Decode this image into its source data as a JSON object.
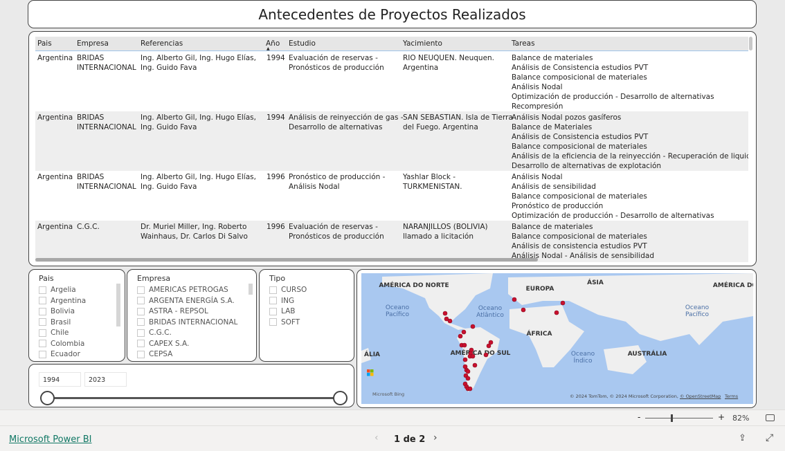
{
  "title": "Antecedentes de Proyectos Realizados",
  "table": {
    "columns": [
      "Pais",
      "Empresa",
      "Referencias",
      "Año",
      "Estudio",
      "Yacimiento",
      "Tareas"
    ],
    "sorted_column": "Año",
    "rows": [
      {
        "pais": "Argentina",
        "empresa": [
          "BRIDAS",
          "INTERNACIONAL"
        ],
        "referencias": [
          "Ing. Alberto Gil, Ing. Hugo Elías,",
          "Ing. Guido Fava"
        ],
        "anio": "1994",
        "estudio": [
          "Evaluación de reservas -",
          "Pronósticos de producción"
        ],
        "yacimiento": [
          "RIO NEUQUEN. Neuquen.",
          "Argentina"
        ],
        "tareas": [
          "Balance de materiales",
          "Análisis de Consistencia estudios PVT",
          "Balance composicional de materiales",
          "Análisis Nodal",
          "Optimización de producción - Desarrollo de alternativas",
          "Recompresión"
        ]
      },
      {
        "pais": "Argentina",
        "empresa": [
          "BRIDAS",
          "INTERNACIONAL"
        ],
        "referencias": [
          "Ing. Alberto Gil, Ing. Hugo Elías,",
          "Ing. Guido Fava"
        ],
        "anio": "1994",
        "estudio": [
          "Análisis de reinyección de gas -",
          "Desarrollo de alternativas"
        ],
        "yacimiento": [
          "SAN SEBASTIAN. Isla de Tierra",
          "del Fuego. Argentina"
        ],
        "tareas": [
          "Análisis Nodal pozos gasíferos",
          "Balance de Materiales",
          "Análisis de Consistencia estudios PVT",
          "Balance composicional de materiales",
          "Análisis de la eficiencia de la reinyección - Recuperación de liquidos",
          "Desarrollo de alternativas de explotación"
        ]
      },
      {
        "pais": "Argentina",
        "empresa": [
          "BRIDAS",
          "INTERNACIONAL"
        ],
        "referencias": [
          "Ing. Alberto Gil, Ing. Hugo Elías,",
          "Ing. Guido Fava"
        ],
        "anio": "1996",
        "estudio": [
          "Pronóstico de producción -",
          "Análisis Nodal"
        ],
        "yacimiento": [
          "Yashlar Block -",
          "TURKMENISTAN."
        ],
        "tareas": [
          "Análisis Nodal",
          "Análisis de sensibilidad",
          "Balance composicional de materiales",
          "Pronóstico de producción",
          "Optimización de producción - Desarrollo de alternativas"
        ]
      },
      {
        "pais": "Argentina",
        "empresa": [
          "C.G.C."
        ],
        "referencias": [
          "Dr. Muriel Miller, Ing. Roberto",
          "Wainhaus, Dr. Carlos Di Salvo"
        ],
        "anio": "1996",
        "estudio": [
          "Evaluación de reservas -",
          "Pronósticos de producción"
        ],
        "yacimiento": [
          "NARANJILLOS (BOLIVIA)",
          "llamado a licitación"
        ],
        "tareas": [
          "Balance de materiales",
          "Balance composicional de materiales",
          "Análisis de consistencia estudios PVT",
          "Análisis Nodal - Análisis de sensibilidad"
        ]
      }
    ]
  },
  "slicers": {
    "pais": {
      "title": "Pais",
      "options": [
        "Argelia",
        "Argentina",
        "Bolivia",
        "Brasil",
        "Chile",
        "Colombia",
        "Ecuador"
      ]
    },
    "empresa": {
      "title": "Empresa",
      "options": [
        "AMERICAS PETROGAS",
        "ARGENTA ENERGÍA S.A.",
        "ASTRA - REPSOL",
        "BRIDAS INTERNACIONAL",
        "C.G.C.",
        "CAPEX S.A.",
        "CEPSA"
      ]
    },
    "tipo": {
      "title": "Tipo",
      "options": [
        "CURSO",
        "ING",
        "LAB",
        "SOFT"
      ]
    },
    "year": {
      "min": "1994",
      "max": "2023"
    }
  },
  "map": {
    "labels": [
      "AMÉRICA DO NORTE",
      "EUROPA",
      "ÁSIA",
      "AMÉRICA DO",
      "Oceano Pacífico",
      "Oceano Atlântico",
      "ÁFRICA",
      "Oceano Pacífico",
      "ÁLIA",
      "AMÉRICA DO SUL",
      "Oceano Índico",
      "AUSTRÁLIA"
    ],
    "logo": "Microsoft Bing",
    "attribution": "© 2024 TomTom, © 2024 Microsoft Corporation,",
    "osm_link": "© OpenStreetMap",
    "terms_link": "Terms",
    "water_color": "#a9c8f0",
    "land_color": "#efefef",
    "marker_color": "#c8102e"
  },
  "zoom": {
    "level": "82%",
    "minus": "-",
    "plus": "+"
  },
  "footer": {
    "brand": "Microsoft Power BI",
    "page": "1 de 2"
  }
}
